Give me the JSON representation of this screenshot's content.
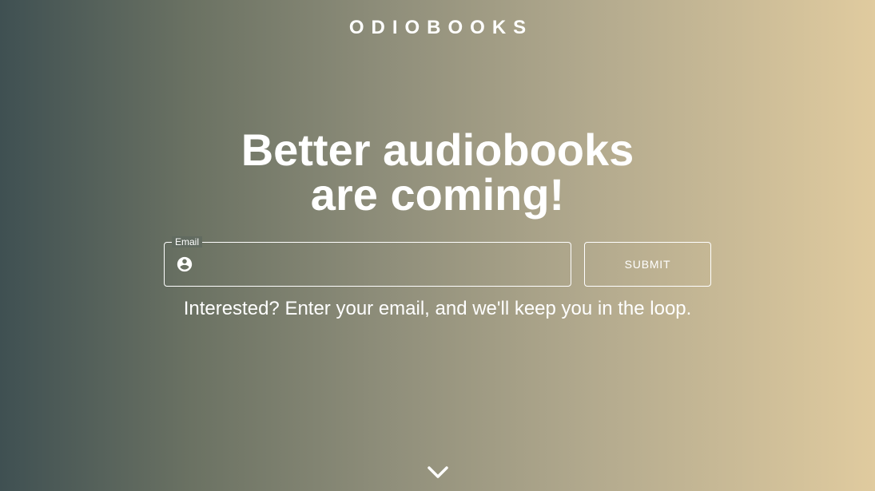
{
  "header": {
    "brand": "ODIOBOOKS"
  },
  "hero": {
    "headline_line1": "Better audiobooks",
    "headline_line2": "are coming!"
  },
  "signup_form": {
    "email_label": "Email",
    "email_value": "",
    "email_icon": "account-circle-icon",
    "submit_label": "SUBMIT",
    "helper_text": "Interested? Enter your email, and we'll keep you in the loop."
  },
  "footer": {
    "scroll_icon": "chevron-down-icon"
  },
  "colors": {
    "gradient_start": "#3f5052",
    "gradient_end": "#e0cb9f",
    "text": "#ffffff"
  }
}
